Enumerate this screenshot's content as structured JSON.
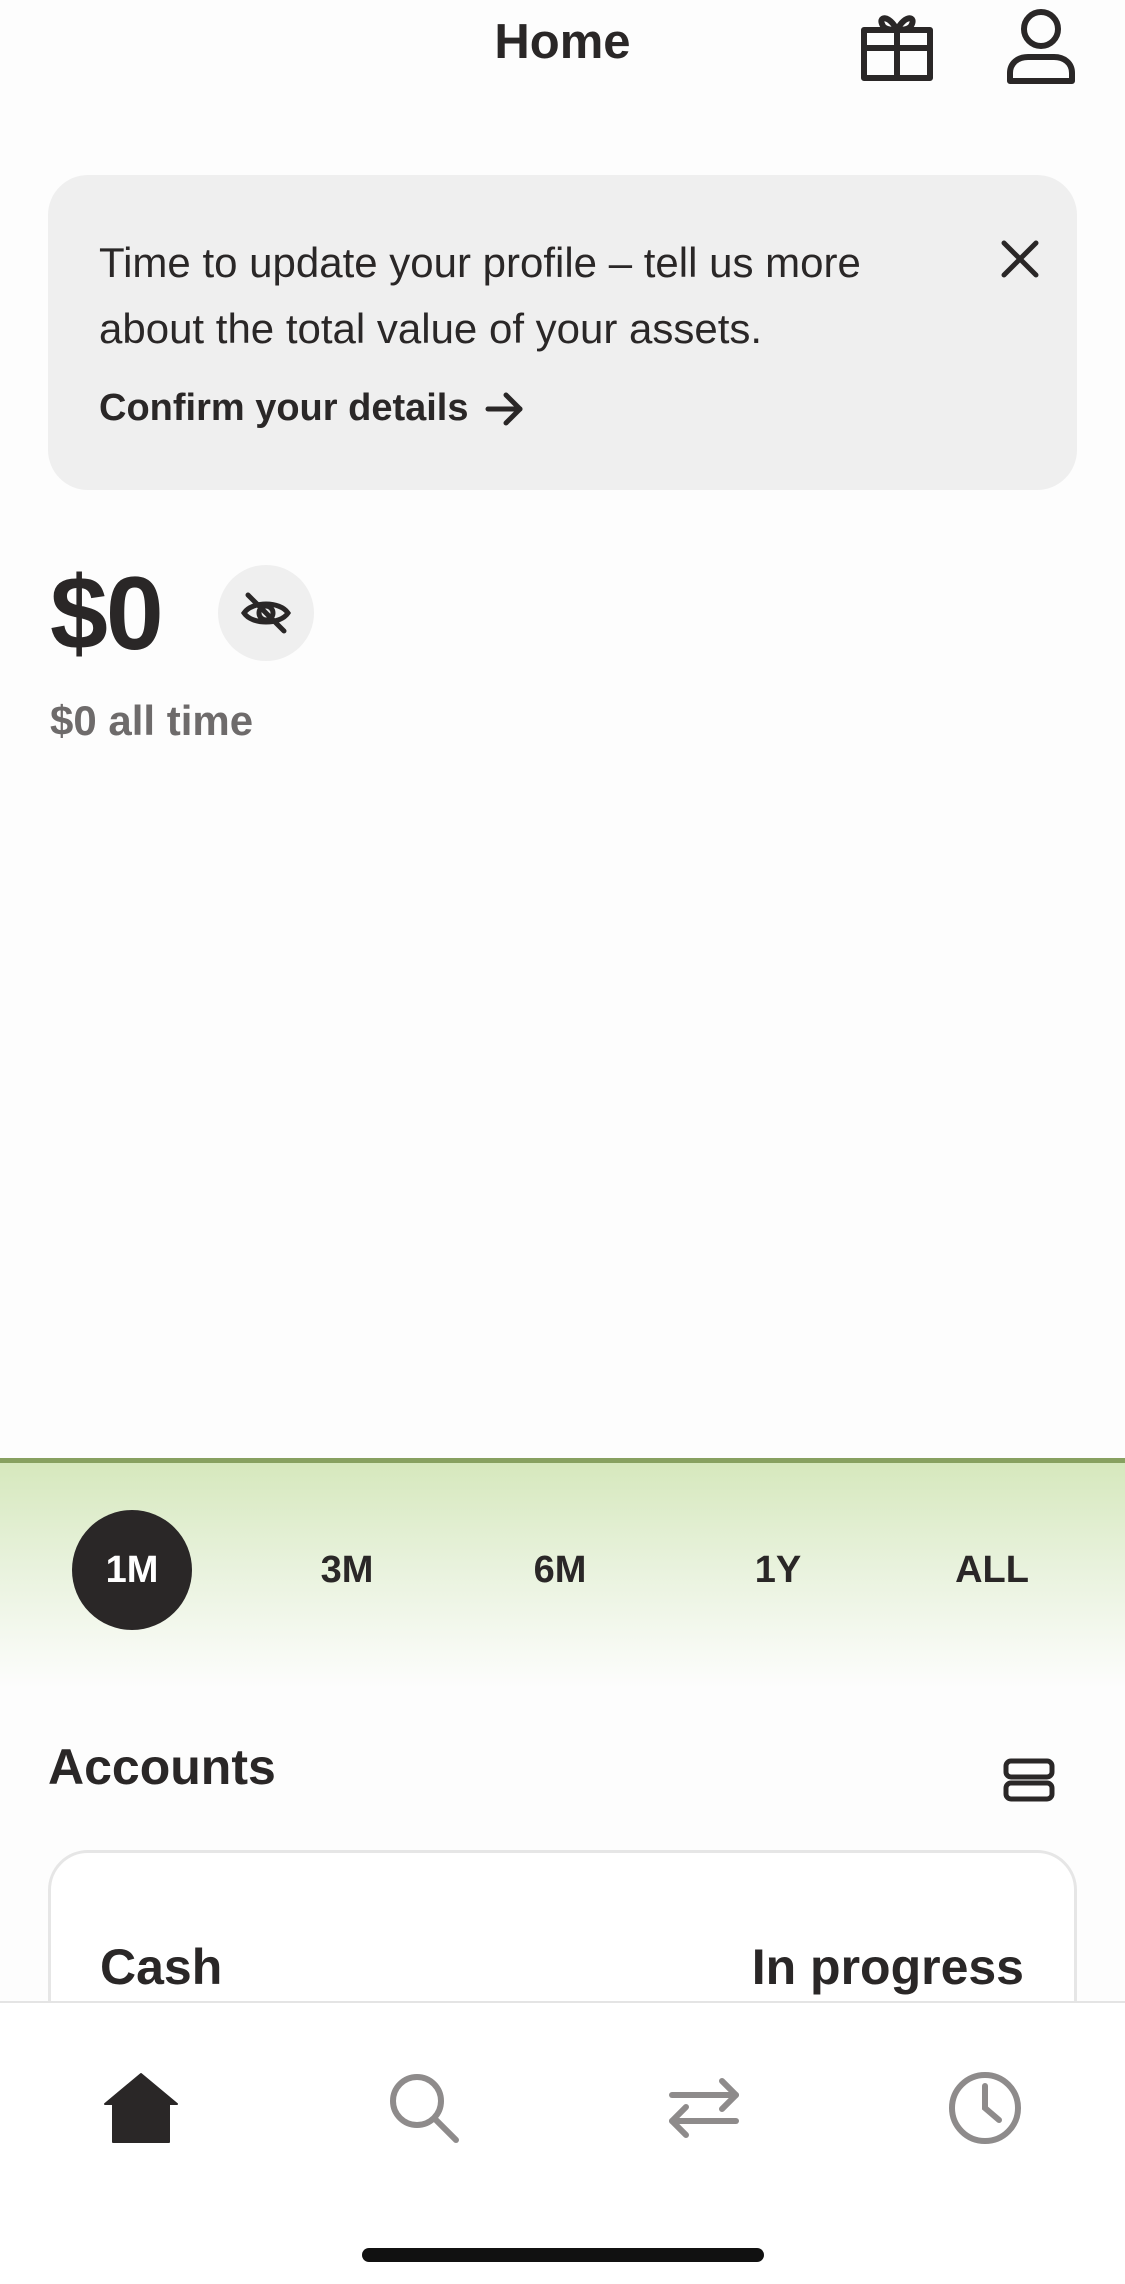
{
  "header": {
    "title": "Home",
    "gift_icon": "gift-icon",
    "profile_icon": "profile-icon"
  },
  "banner": {
    "message": "Time to update your profile – tell us more about the total value of your assets.",
    "cta_label": "Confirm your details",
    "cta_icon": "arrow-right-icon",
    "close_icon": "close-icon"
  },
  "balance": {
    "amount": "$0",
    "all_time": "$0 all time",
    "hide_icon": "eye-off-icon"
  },
  "chart": {
    "line_color": "#87a060",
    "fill_color": "#d6e8bd"
  },
  "ranges": [
    {
      "label": "1M",
      "selected": true
    },
    {
      "label": "3M",
      "selected": false
    },
    {
      "label": "6M",
      "selected": false
    },
    {
      "label": "1Y",
      "selected": false
    },
    {
      "label": "ALL",
      "selected": false
    }
  ],
  "accounts": {
    "title": "Accounts",
    "layout_icon": "stack-icon",
    "cards": [
      {
        "name": "Cash",
        "status": "In progress"
      }
    ]
  },
  "nav": {
    "items": [
      {
        "icon": "home-icon",
        "active": true
      },
      {
        "icon": "search-icon",
        "active": false
      },
      {
        "icon": "transfer-icon",
        "active": false
      },
      {
        "icon": "history-icon",
        "active": false
      }
    ]
  }
}
